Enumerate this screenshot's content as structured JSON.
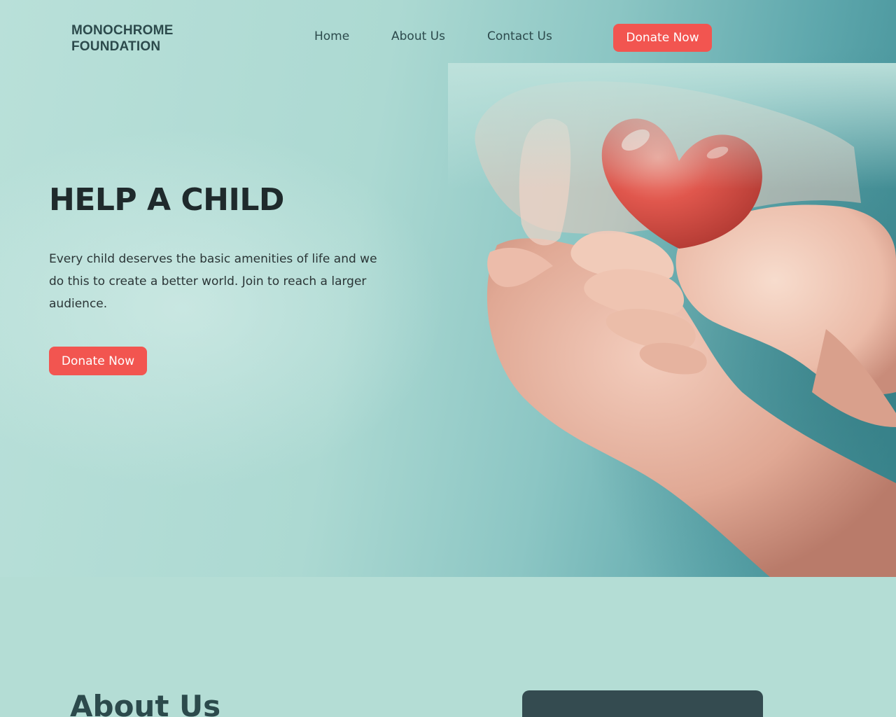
{
  "brand": {
    "name_line1": "MONOCHROME",
    "name_line2": "FOUNDATION"
  },
  "nav": {
    "links": [
      {
        "label": "Home"
      },
      {
        "label": "About Us"
      },
      {
        "label": "Contact Us"
      }
    ],
    "cta_label": "Donate Now"
  },
  "hero": {
    "title": "HELP A CHILD",
    "text": "Every child deserves the basic amenities of life and we do this to create a better world. Join to reach a larger audience.",
    "cta_label": "Donate Now",
    "image": {
      "icon": "hands-holding-heart-photo"
    }
  },
  "about": {
    "title": "About Us"
  },
  "colors": {
    "accent": "#f25550",
    "background": "#b4ddd5",
    "text_dark": "#2c4a4c",
    "card": "#344b50"
  }
}
